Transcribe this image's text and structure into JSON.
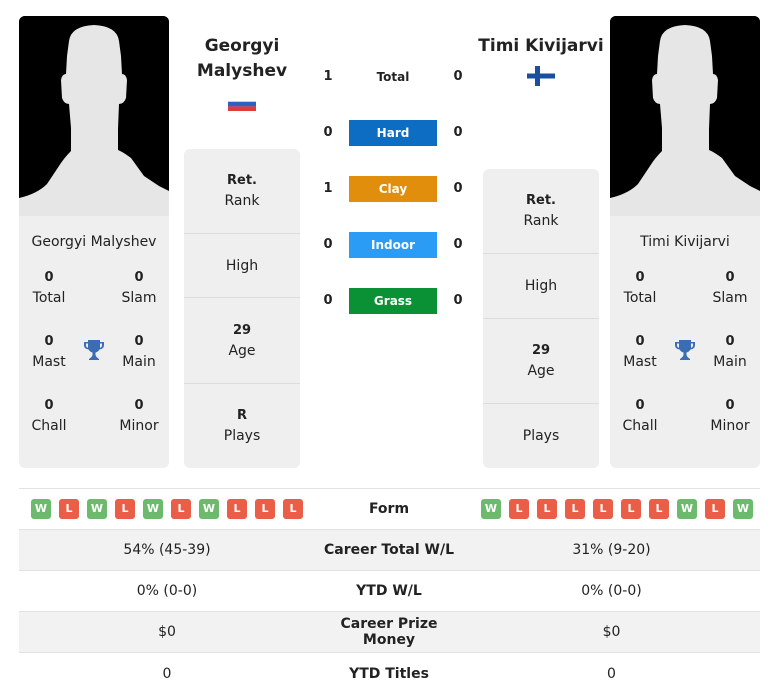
{
  "colors": {
    "hard": "#0c6dc2",
    "clay": "#e08e0b",
    "indoor": "#2b9cf5",
    "grass": "#0a9136",
    "win": "#6cba6c",
    "loss": "#ea5e48",
    "trophy": "#3b6db5"
  },
  "player1": {
    "name": "Georgyi Malyshev",
    "header_name_line1": "Georgyi",
    "header_name_line2": "Malyshev",
    "flag": "russia-flag",
    "titles": {
      "total": {
        "value": "0",
        "label": "Total"
      },
      "slam": {
        "value": "0",
        "label": "Slam"
      },
      "mast": {
        "value": "0",
        "label": "Mast"
      },
      "main": {
        "value": "0",
        "label": "Main"
      },
      "chall": {
        "value": "0",
        "label": "Chall"
      },
      "minor": {
        "value": "0",
        "label": "Minor"
      }
    },
    "info": {
      "rank": {
        "value": "Ret.",
        "label": "Rank"
      },
      "high": {
        "value": "",
        "label": "High"
      },
      "age": {
        "value": "29",
        "label": "Age"
      },
      "plays": {
        "value": "R",
        "label": "Plays"
      }
    },
    "form": [
      "W",
      "L",
      "W",
      "L",
      "W",
      "L",
      "W",
      "L",
      "L",
      "L"
    ],
    "career_wl": "54% (45-39)",
    "ytd_wl": "0% (0-0)",
    "prize_money": "$0",
    "ytd_titles": "0"
  },
  "player2": {
    "name": "Timi Kivijarvi",
    "header_name": "Timi Kivijarvi",
    "flag": "finland-flag",
    "titles": {
      "total": {
        "value": "0",
        "label": "Total"
      },
      "slam": {
        "value": "0",
        "label": "Slam"
      },
      "mast": {
        "value": "0",
        "label": "Mast"
      },
      "main": {
        "value": "0",
        "label": "Main"
      },
      "chall": {
        "value": "0",
        "label": "Chall"
      },
      "minor": {
        "value": "0",
        "label": "Minor"
      }
    },
    "info": {
      "rank": {
        "value": "Ret.",
        "label": "Rank"
      },
      "high": {
        "value": "",
        "label": "High"
      },
      "age": {
        "value": "29",
        "label": "Age"
      },
      "plays": {
        "value": "",
        "label": "Plays"
      }
    },
    "form": [
      "W",
      "L",
      "L",
      "L",
      "L",
      "L",
      "L",
      "W",
      "L",
      "W"
    ],
    "career_wl": "31% (9-20)",
    "ytd_wl": "0% (0-0)",
    "prize_money": "$0",
    "ytd_titles": "0"
  },
  "h2h": [
    {
      "surface": "Total",
      "p1": "1",
      "p2": "0"
    },
    {
      "surface": "Hard",
      "p1": "0",
      "p2": "0"
    },
    {
      "surface": "Clay",
      "p1": "1",
      "p2": "0"
    },
    {
      "surface": "Indoor",
      "p1": "0",
      "p2": "0"
    },
    {
      "surface": "Grass",
      "p1": "0",
      "p2": "0"
    }
  ],
  "stats_labels": {
    "form": "Form",
    "career_wl": "Career Total W/L",
    "ytd_wl": "YTD W/L",
    "prize_money": "Career Prize Money",
    "ytd_titles": "YTD Titles"
  }
}
